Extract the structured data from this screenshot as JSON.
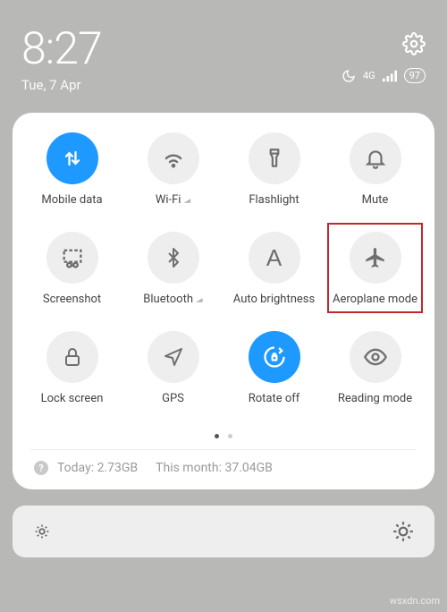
{
  "status": {
    "time": "8:27",
    "date": "Tue, 7 Apr",
    "network_label": "4G",
    "battery_text": "97"
  },
  "tiles": [
    {
      "key": "mobile-data",
      "label": "Mobile data",
      "active": true,
      "expander": false
    },
    {
      "key": "wifi",
      "label": "Wi-Fi",
      "active": false,
      "expander": true
    },
    {
      "key": "flashlight",
      "label": "Flashlight",
      "active": false,
      "expander": false
    },
    {
      "key": "mute",
      "label": "Mute",
      "active": false,
      "expander": false
    },
    {
      "key": "screenshot",
      "label": "Screenshot",
      "active": false,
      "expander": false
    },
    {
      "key": "bluetooth",
      "label": "Bluetooth",
      "active": false,
      "expander": true
    },
    {
      "key": "auto-brightness",
      "label": "Auto brightness",
      "active": false,
      "expander": false
    },
    {
      "key": "aeroplane-mode",
      "label": "Aeroplane mode",
      "active": false,
      "expander": false,
      "highlight": true
    },
    {
      "key": "lock-screen",
      "label": "Lock screen",
      "active": false,
      "expander": false
    },
    {
      "key": "gps",
      "label": "GPS",
      "active": false,
      "expander": false
    },
    {
      "key": "rotate-off",
      "label": "Rotate off",
      "active": true,
      "expander": false
    },
    {
      "key": "reading-mode",
      "label": "Reading mode",
      "active": false,
      "expander": false
    }
  ],
  "usage": {
    "today_label": "Today:",
    "today_value": "2.73GB",
    "month_label": "This month:",
    "month_value": "37.04GB"
  },
  "watermark": "wsxdn.com"
}
